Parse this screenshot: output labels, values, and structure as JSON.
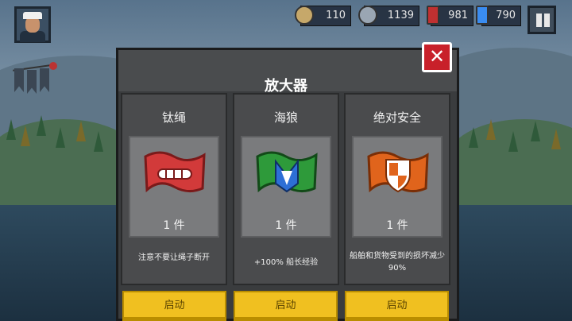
{
  "hud": {
    "resources": [
      {
        "name": "coins",
        "value": "110",
        "color": "#c6a86a"
      },
      {
        "name": "silver",
        "value": "1139",
        "color": "#9aa6b3"
      },
      {
        "name": "cards",
        "value": "981",
        "color": "#c03030"
      },
      {
        "name": "energy",
        "value": "790",
        "color": "#3a8cf0"
      }
    ]
  },
  "modal": {
    "title": "放大器",
    "close_label": "✕",
    "cards": [
      {
        "name": "钛绳",
        "quantity": "1 件",
        "description": "注意不要让绳子断开",
        "button": "启动",
        "flag_color": "#d23a3a",
        "icon": "rope-icon"
      },
      {
        "name": "海狼",
        "quantity": "1 件",
        "description": "+100% 船长经验",
        "button": "启动",
        "flag_color": "#2e9a3a",
        "icon": "wolf-icon"
      },
      {
        "name": "绝对安全",
        "quantity": "1 件",
        "description": "船舶和货物受到的损坏减少 90%",
        "button": "启动",
        "flag_color": "#e0641c",
        "icon": "shield-icon"
      }
    ]
  }
}
